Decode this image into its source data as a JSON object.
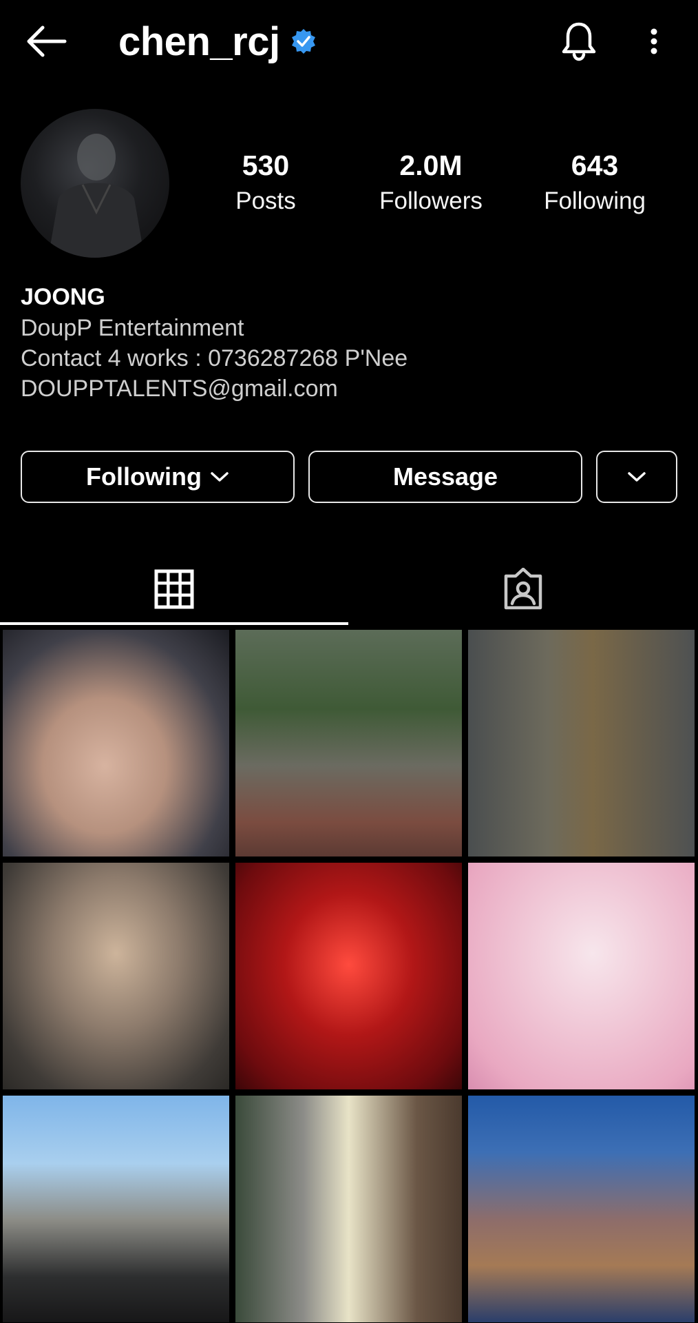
{
  "header": {
    "username": "chen_rcj",
    "verified": true,
    "icons": {
      "back": "arrow-left-icon",
      "verified": "verified-badge-icon",
      "notifications": "bell-icon",
      "more": "more-vertical-icon"
    }
  },
  "profile": {
    "avatar_alt": "profile photo",
    "stats": [
      {
        "value": "530",
        "label": "Posts"
      },
      {
        "value": "2.0M",
        "label": "Followers"
      },
      {
        "value": "643",
        "label": "Following"
      }
    ],
    "bio": {
      "name": "JOONG",
      "lines": [
        "DoupP Entertainment",
        "Contact 4 works : 0736287268 P'Nee",
        "DOUPPTALENTS@gmail.com"
      ]
    }
  },
  "actions": {
    "following_label": "Following",
    "message_label": "Message"
  },
  "tabs": {
    "active": "grid",
    "items": [
      "grid-icon",
      "tagged-icon"
    ]
  },
  "colors": {
    "background": "#000000",
    "text": "#ffffff",
    "verified": "#3797f0",
    "secondary_text": "#cfcfcf"
  },
  "posts": [
    {
      "desc": "close-up selfie"
    },
    {
      "desc": "sitting on lounger under umbrella"
    },
    {
      "desc": "olive jacket with strap"
    },
    {
      "desc": "smiling in grey tee"
    },
    {
      "desc": "red-lit photo with glasses"
    },
    {
      "desc": "pink hoodie smiling"
    },
    {
      "desc": "beach pier in black shirt"
    },
    {
      "desc": "street with drink"
    },
    {
      "desc": "seated in plaid blazer"
    }
  ]
}
